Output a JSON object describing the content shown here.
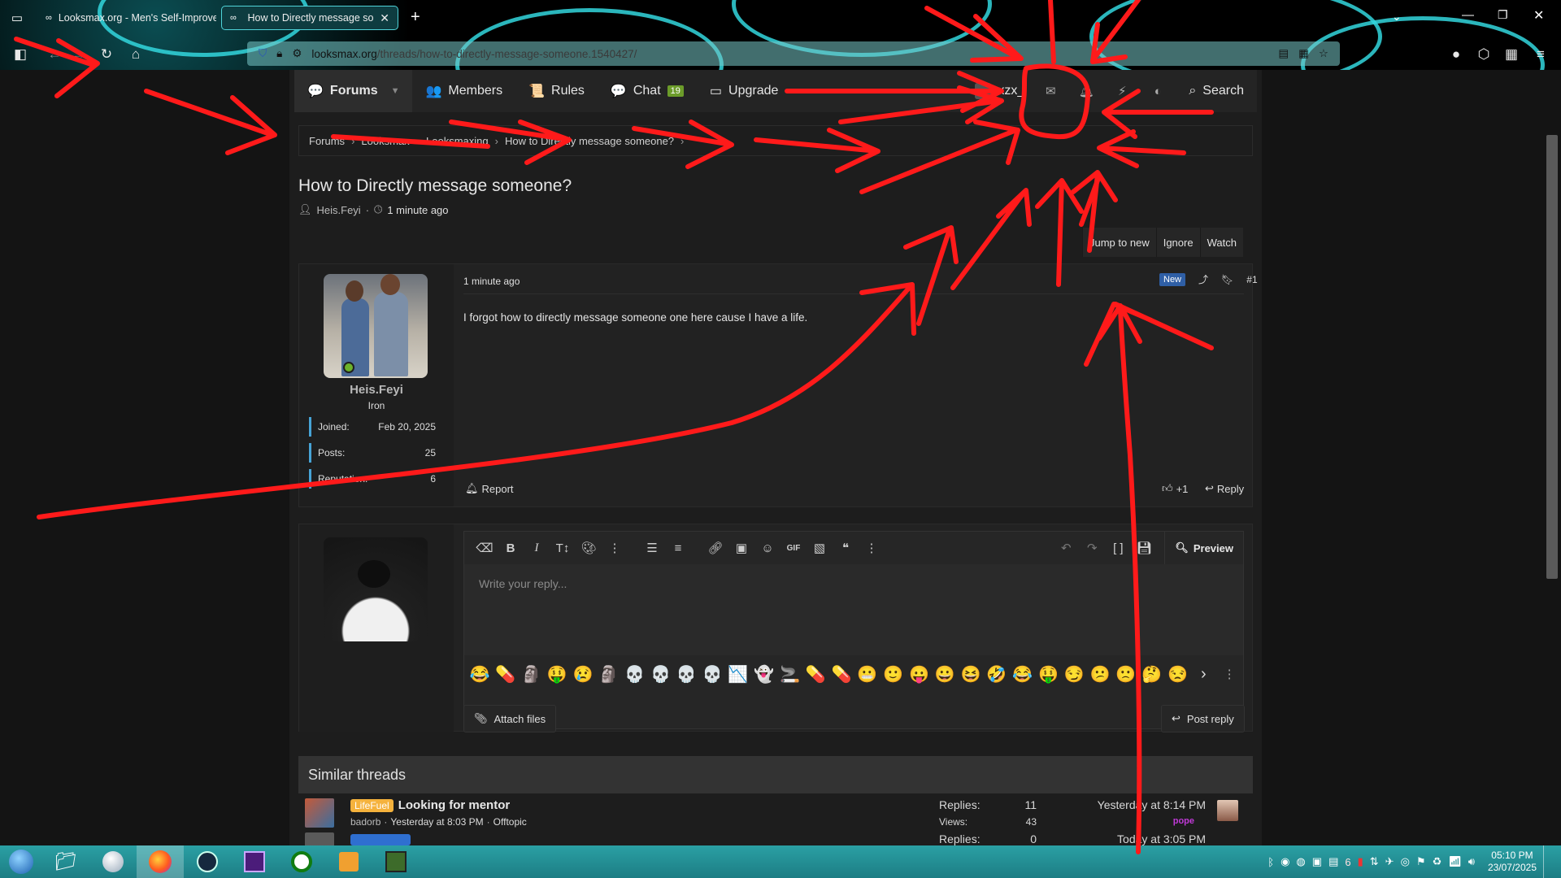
{
  "browser": {
    "tabs": [
      {
        "title": "Looksmax.org - Men's Self-Improvement",
        "active": false
      },
      {
        "title": "How to Directly message someone?",
        "active": true
      }
    ],
    "new_tab": "+",
    "url_host": "looksmax.org",
    "url_path": "/threads/how-to-directly-message-someone.1540427/"
  },
  "nav": {
    "items": [
      {
        "label": "Forums",
        "icon": "comments-icon"
      },
      {
        "label": "Members",
        "icon": "users-icon"
      },
      {
        "label": "Rules",
        "icon": "scroll-icon"
      },
      {
        "label": "Chat",
        "icon": "chat-icon",
        "badge": "19"
      },
      {
        "label": "Upgrade",
        "icon": "card-icon"
      }
    ],
    "username": "xzx_",
    "search_label": "Search"
  },
  "breadcrumb": [
    "Forums",
    "Looksmax",
    "Looksmaxing",
    "How to Directly message someone?"
  ],
  "thread": {
    "title": "How to Directly message someone?",
    "author": "Heis.Feyi",
    "time": "1 minute ago",
    "actions": [
      "Jump to new",
      "Ignore",
      "Watch"
    ]
  },
  "post": {
    "time": "1 minute ago",
    "new_badge": "New",
    "number": "#1",
    "body": "I forgot how to directly message someone one here cause I have a life.",
    "report": "Report",
    "likes": "+1",
    "reply": "Reply",
    "user": {
      "name": "Heis.Feyi",
      "rank": "Iron",
      "stats": [
        {
          "label": "Joined:",
          "value": "Feb 20, 2025"
        },
        {
          "label": "Posts:",
          "value": "25"
        },
        {
          "label": "Reputation:",
          "value": "6"
        }
      ]
    }
  },
  "editor": {
    "placeholder": "Write your reply...",
    "preview": "Preview",
    "attach": "Attach files",
    "post_reply": "Post reply",
    "emojis": [
      "😂",
      "💊",
      "🗿",
      "🤑",
      "😢",
      "🗿",
      "💀",
      "💀",
      "💀",
      "💀",
      "📉",
      "👻",
      "🚬",
      "💊",
      "💊",
      "😬",
      "🙂",
      "😛",
      "😀",
      "😆",
      "🤣",
      "😂",
      "🤑",
      "😏",
      "😕",
      "🙁",
      "🤔",
      "😒"
    ]
  },
  "similar": {
    "heading": "Similar threads",
    "rows": [
      {
        "prefix": "LifeFuel",
        "title": "Looking for mentor",
        "author": "badorb",
        "date": "Yesterday at 8:03 PM",
        "forum": "Offtopic",
        "replies_label": "Replies:",
        "replies": "11",
        "views_label": "Views:",
        "views": "43",
        "last": "Yesterday at 8:14 PM",
        "last_user": "pope"
      },
      {
        "prefix": "",
        "title": "",
        "author": "",
        "date": "",
        "forum": "",
        "replies_label": "Replies:",
        "replies": "0",
        "views_label": "",
        "views": "",
        "last": "Today at 3:05 PM",
        "last_user": ""
      }
    ]
  },
  "taskbar": {
    "time": "05:10 PM",
    "date": "23/07/2025",
    "tray_number": "6"
  }
}
